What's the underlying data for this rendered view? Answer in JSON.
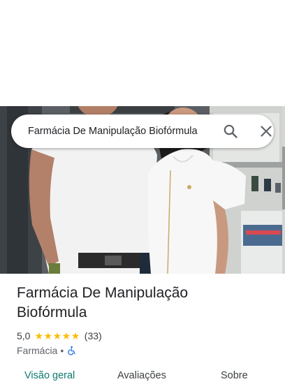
{
  "search": {
    "query": "Farmácia De Manipulação Biofórmula"
  },
  "place": {
    "name": "Farmácia De Manipulação Biofórmula",
    "rating": "5,0",
    "stars": 5,
    "review_count": "(33)",
    "category": "Farmácia",
    "separator": "•",
    "accessibility_icon": "wheelchair-icon"
  },
  "tabs": [
    {
      "label": "Visão geral",
      "active": true
    },
    {
      "label": "Avaliações",
      "active": false
    },
    {
      "label": "Sobre",
      "active": false
    }
  ],
  "colors": {
    "active_tab": "#0b7a6e",
    "star": "#fbbc04",
    "accessibility": "#1a73e8"
  }
}
